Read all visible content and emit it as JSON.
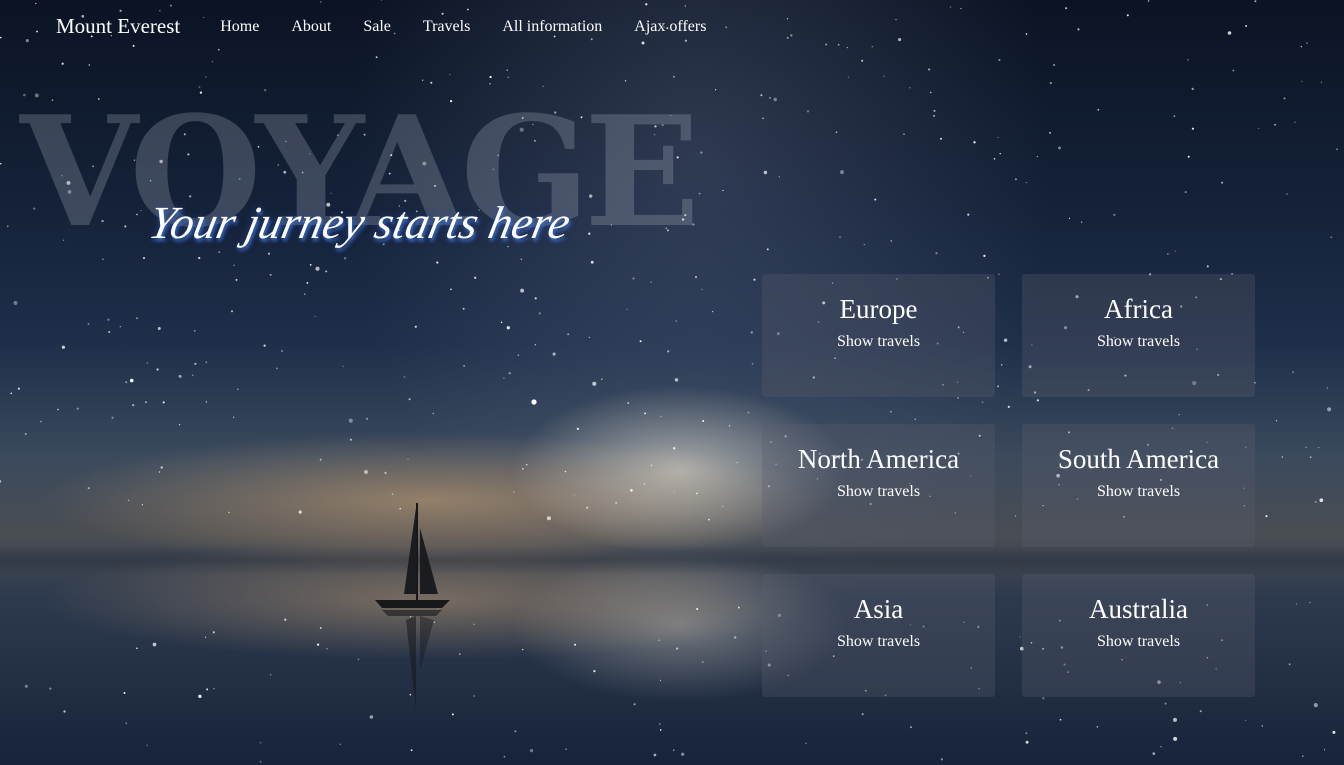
{
  "nav": {
    "brand": "Mount Everest",
    "links": [
      "Home",
      "About",
      "Sale",
      "Travels",
      "All information",
      "Ajax offers"
    ]
  },
  "hero": {
    "word": "VOYAGE",
    "tagline": "Your jurney starts here"
  },
  "regions": [
    {
      "name": "Europe",
      "link": "Show travels"
    },
    {
      "name": "Africa",
      "link": "Show travels"
    },
    {
      "name": "North America",
      "link": "Show travels"
    },
    {
      "name": "South America",
      "link": "Show travels"
    },
    {
      "name": "Asia",
      "link": "Show travels"
    },
    {
      "name": "Australia",
      "link": "Show travels"
    }
  ],
  "colors": {
    "sky_top": "#0b1424",
    "sky_mid": "#1f2f4a",
    "horizon_glow": "#d6aa78",
    "card_bg": "#5a5c6e",
    "tagline_glow": "#3c6ec8"
  }
}
